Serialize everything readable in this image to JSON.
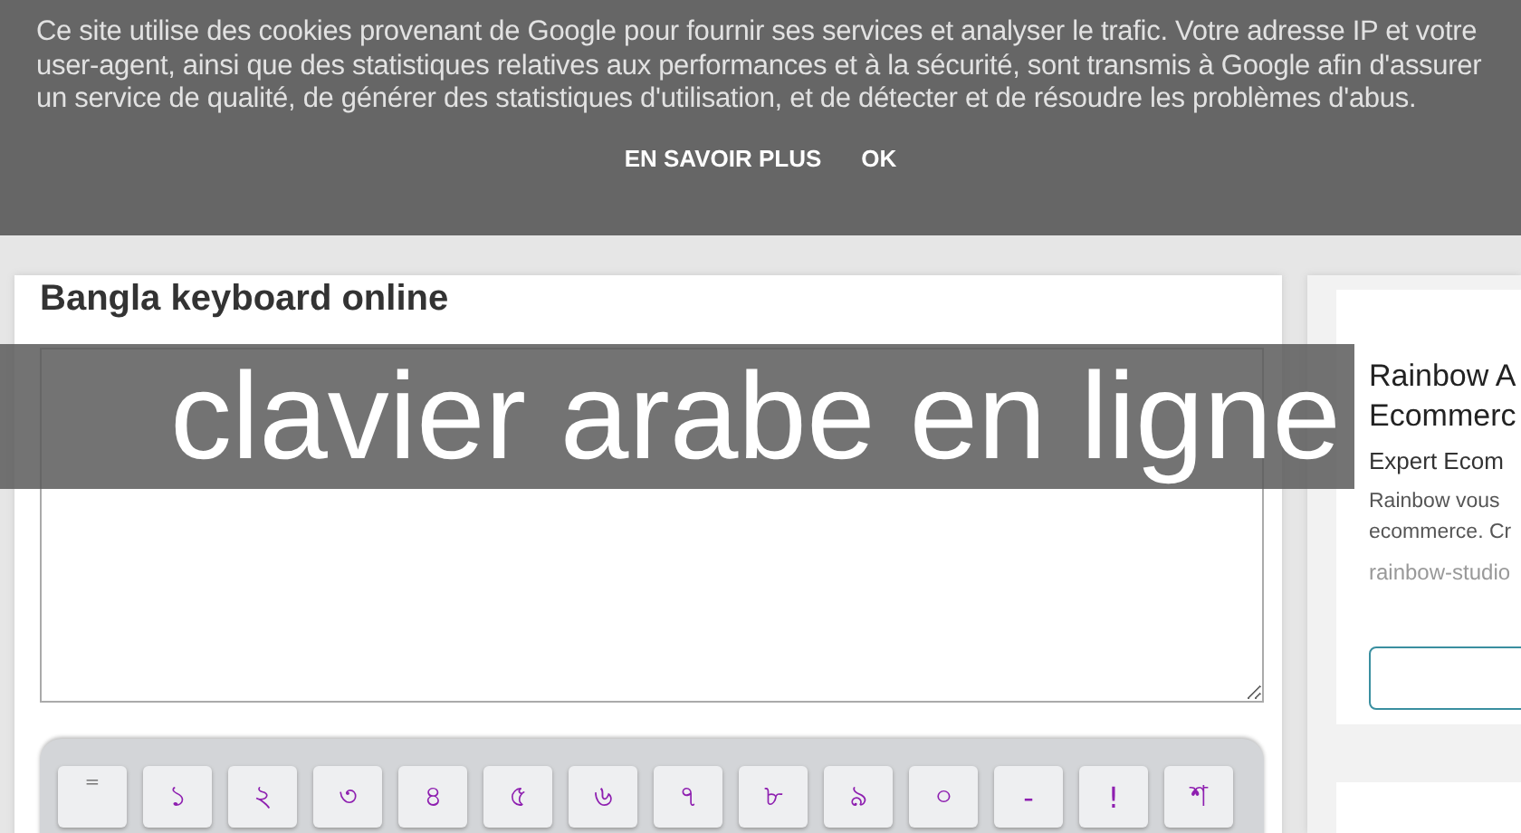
{
  "cookie_notice": {
    "text": "Ce site utilise des cookies provenant de Google pour fournir ses services et analyser le trafic. Votre adresse IP et votre user-agent, ainsi que des statistiques relatives aux performances et à la sécurité, sont transmis à Google afin d'assurer un service de qualité, de générer des statistiques d'utilisation, et de détecter et de résoudre les problèmes d'abus.",
    "buttons": [
      "EN SAVOIR PLUS",
      "OK"
    ]
  },
  "overlay_title": "clavier arabe en ligne",
  "main": {
    "title": "Bangla keyboard online",
    "keys": [
      "=",
      "১",
      "২",
      "৩",
      "৪",
      "৫",
      "৬",
      "৭",
      "৮",
      "৯",
      "০",
      "-",
      "!",
      "শ"
    ]
  },
  "sidebar_ad": {
    "title_lines": [
      "Rainbow A",
      "Ecommerc"
    ],
    "subtitle": "Expert Ecom",
    "text_lines": [
      "Rainbow vous",
      "ecommerce. Cr"
    ],
    "url": "rainbow-studio"
  }
}
